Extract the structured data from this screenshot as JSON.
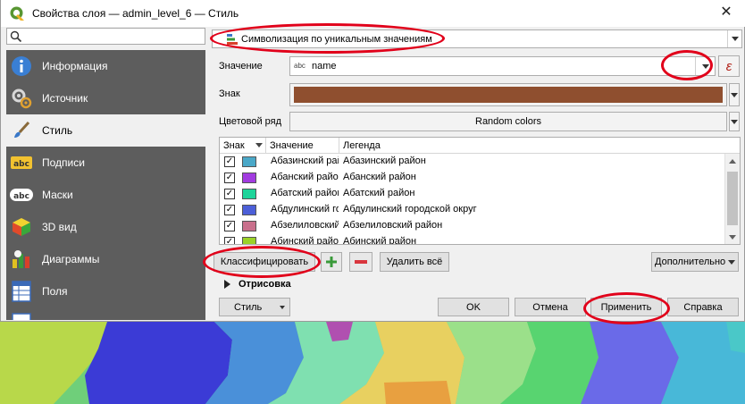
{
  "window": {
    "title": "Свойства слоя — admin_level_6 — Стиль",
    "close_glyph": "✕"
  },
  "search": {
    "value": ""
  },
  "sidebar": {
    "items": [
      {
        "label": "Информация",
        "icon": "info-icon"
      },
      {
        "label": "Источник",
        "icon": "source-icon"
      },
      {
        "label": "Стиль",
        "icon": "paintbrush-icon",
        "active": true
      },
      {
        "label": "Подписи",
        "icon": "labels-icon",
        "badge": "abc"
      },
      {
        "label": "Маски",
        "icon": "masks-icon",
        "badge": "abc"
      },
      {
        "label": "3D вид",
        "icon": "cube-icon"
      },
      {
        "label": "Диаграммы",
        "icon": "diagrams-icon"
      },
      {
        "label": "Поля",
        "icon": "fields-icon"
      }
    ]
  },
  "style": {
    "renderer": "Символизация по уникальным значениям",
    "value_label": "Значение",
    "value_type_badge": "abc",
    "value_field": "name",
    "expression_glyph": "ε",
    "symbol_label": "Знак",
    "symbol_color": "#8f4f2f",
    "ramp_label": "Цветовой ряд",
    "ramp_value": "Random colors"
  },
  "table": {
    "headers": {
      "symbol": "Знак",
      "value": "Значение",
      "legend": "Легенда"
    },
    "check_glyph": "✓",
    "rows": [
      {
        "checked": true,
        "color": "#4aa8c8",
        "value": "Абазинский район",
        "legend": "Абазинский район"
      },
      {
        "checked": true,
        "color": "#a23ce0",
        "value": "Абанский район",
        "legend": "Абанский район"
      },
      {
        "checked": true,
        "color": "#1ed49a",
        "value": "Абатский район",
        "legend": "Абатский район"
      },
      {
        "checked": true,
        "color": "#4c5fd8",
        "value": "Абдулинский городской округ",
        "legend": "Абдулинский городской округ"
      },
      {
        "checked": true,
        "color": "#c9708c",
        "value": "Абзелиловский район",
        "legend": "Абзелиловский район"
      },
      {
        "checked": true,
        "color": "#9bd228",
        "value": "Абинский район",
        "legend": "Абинский район"
      }
    ]
  },
  "buttons": {
    "classify": "Классифицировать",
    "delete_all": "Удалить всё",
    "advanced": "Дополнительно",
    "style": "Стиль",
    "ok": "OK",
    "cancel": "Отмена",
    "apply": "Применить",
    "help": "Справка"
  },
  "rendering": {
    "label": "Отрисовка"
  },
  "colors": {
    "sidebar_bg": "#5d5d5d",
    "highlight": "#e1001a",
    "add_green": "#3a9a3a",
    "remove_red": "#d9363e"
  }
}
